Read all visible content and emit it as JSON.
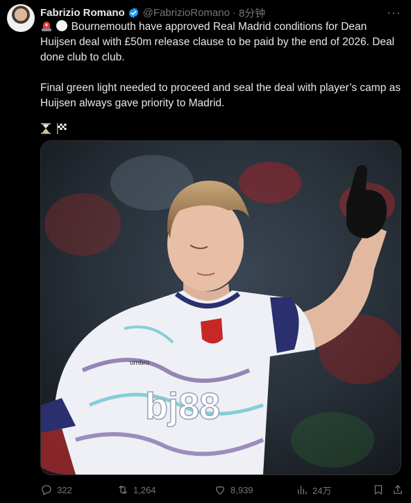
{
  "author": {
    "name": "Fabrizio Romano",
    "handle": "@FabrizioRomano",
    "separator": "·",
    "time": "8分钟"
  },
  "tweet": {
    "para1": "Bournemouth have approved Real Madrid conditions for Dean Huijsen deal with £50m release clause to be paid by the end of 2026. Deal done club to club.",
    "para2": "Final green light needed to proceed and seal the deal with player’s camp as Huijsen always gave priority to Madrid."
  },
  "media": {
    "sponsor": "bj88",
    "kit_brand": "umbro"
  },
  "actions": {
    "replies": "322",
    "reposts": "1,264",
    "likes": "8,939",
    "views": "24万"
  },
  "colors": {
    "background": "#000000",
    "text": "#e7e9ea",
    "muted": "#71767b",
    "verified": "#1d9bf0"
  },
  "icons": [
    "siren-icon",
    "white-circle-icon",
    "hourglass-icon",
    "chequered-flag-icon",
    "verified-badge-icon",
    "more-icon",
    "reply-icon",
    "repost-icon",
    "like-icon",
    "views-icon",
    "bookmark-icon",
    "share-icon"
  ]
}
